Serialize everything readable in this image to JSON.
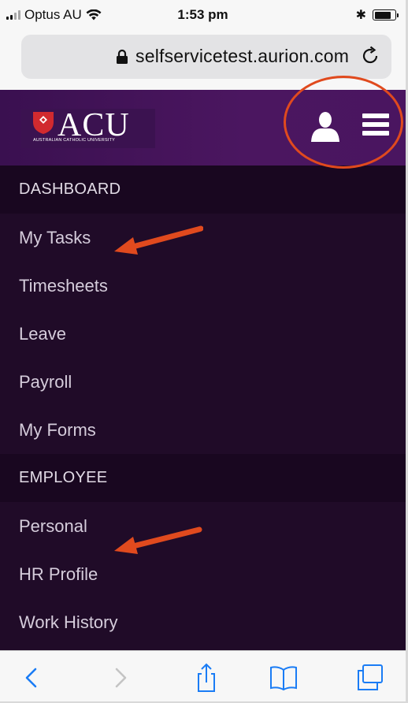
{
  "status_bar": {
    "carrier": "Optus AU",
    "time": "1:53 pm",
    "bluetooth_symbol": "✱"
  },
  "browser": {
    "url": "selfservicetest.aurion.com"
  },
  "header": {
    "logo_text": "ACU",
    "logo_subtitle": "AUSTRALIAN CATHOLIC UNIVERSITY",
    "colors": {
      "background": "#4b1660",
      "logo_red": "#d12a2f"
    }
  },
  "nav": {
    "dashboard_label": "DASHBOARD",
    "dashboard_items": [
      "My Tasks",
      "Timesheets",
      "Leave",
      "Payroll",
      "My Forms"
    ],
    "employee_label": "EMPLOYEE",
    "employee_items": [
      "Personal",
      "HR Profile",
      "Work History"
    ],
    "colors": {
      "background": "#200b28",
      "section": "#190720"
    }
  },
  "annotations": {
    "color": "#e04a1e"
  },
  "icons": {
    "signal": "signal-icon",
    "wifi": "wifi-icon",
    "bluetooth": "bluetooth-icon",
    "battery": "battery-icon",
    "lock": "lock-icon",
    "reload": "reload-icon",
    "user": "user-icon",
    "menu": "hamburger-menu-icon",
    "back": "back-chevron-icon",
    "forward": "forward-chevron-icon",
    "share": "share-icon",
    "bookmarks": "book-icon",
    "tabs": "tabs-icon"
  }
}
